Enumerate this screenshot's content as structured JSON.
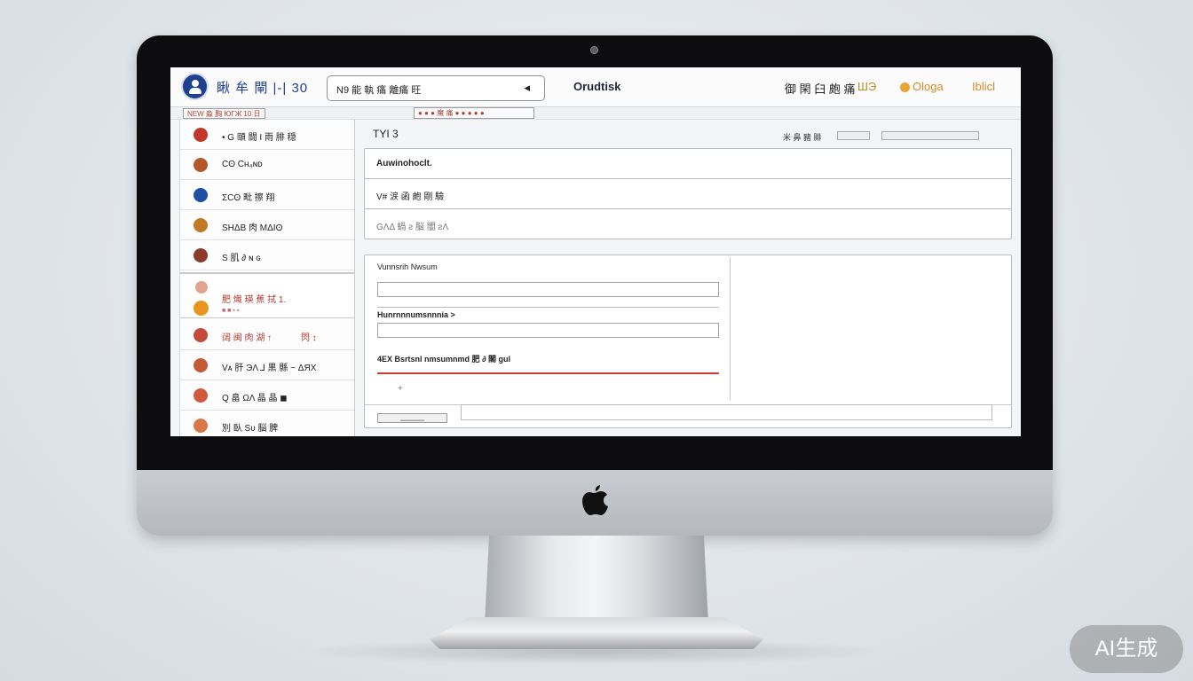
{
  "header": {
    "app_title": "瞅 牟 閘 |-| 30",
    "search_value": "N9 能 執 痛 離痛 旺",
    "brand": "Orudtisk",
    "link_1": "御 閑 臼 皰 痛",
    "link_accent": "ШЭ",
    "link_orange": "Ologa",
    "link_orange_2": "Iblicl"
  },
  "subbar": {
    "breadcrumb": "NEW 淼 胸 ЮΓЖ 10 日",
    "filters": "● ● ● 魔 痛 ● ● ● ● ●"
  },
  "sidebar": {
    "items": [
      {
        "label": "• G 頤 闘 I 雨 腓 穏",
        "color": "#c0392b"
      },
      {
        "label": "Cʘ Cʜ₄ɴᴅ",
        "color": "#b5572d"
      },
      {
        "label": "ΣCʘ 毗 擦 翔",
        "color": "#1f4fa5"
      },
      {
        "label": "SHΔB 肉 MΔIʘ",
        "color": "#c27a27"
      },
      {
        "label": "S 肌 ∂ ɴ ɢ",
        "color": "#8a3b2a"
      }
    ],
    "section": {
      "label": "肥 熾 瑛 蕉 拭 1.",
      "sub": "■ ■ ▪ ▪"
    },
    "items2": [
      {
        "label": "阔 闽 肉 湖 ↑",
        "extra": "閃 ↕",
        "color": "#c44b3a"
      },
      {
        "label": "Vᴀ 肝 ЭΛ ⅃ 黒 縣 ~ ΔЯX",
        "color": "#c25a36"
      },
      {
        "label": "Q 畠 ΩΛ 晶 晶 ◼",
        "color": "#cf5a3f"
      },
      {
        "label": "別 臥 Sᴜ 脳 脾",
        "color": "#d6784a"
      }
    ]
  },
  "main": {
    "title": "TYI 3",
    "right_label": "米 鼻 豬 腓",
    "list_rows": [
      "Auwinohoclt.",
      "V# 涙 函 皰 剛 驗",
      "GΛΔ 蝸 ƨ 脳 闇 ƨΛ"
    ],
    "form": {
      "label_1": "Vunnsrih  Nwsum",
      "label_2": "Hunrnnnumsnnnia >",
      "label_3": "4EX  Bsrtsnl  nmsumnmd  肥 ∂ 閣 gul",
      "cursor": "+",
      "footer_button": "▁▁▁▁▁"
    }
  },
  "watermark": "AI生成"
}
